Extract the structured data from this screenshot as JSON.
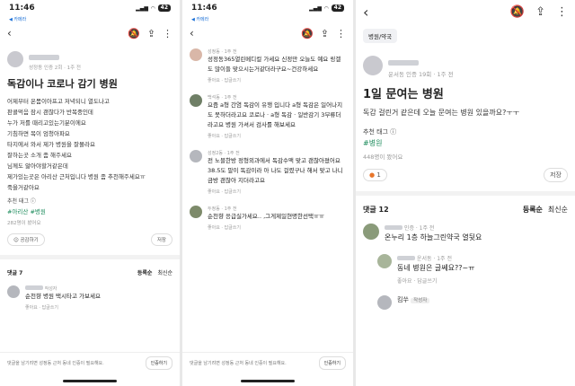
{
  "panel1": {
    "status_time": "11:46",
    "status_sub": "◀ 카메라",
    "battery": "42",
    "meta": "성정동 인증 2회 · 1주 전",
    "title": "독감이나 코로나 감기 병원",
    "body_lines": [
      "어제부터 온몸이아프고 저녁되니 열도나고",
      "판콜먹음 잠시 괜찮다가 반복중인데",
      "누가 저를 때리고있는기분이에요",
      "기침하면 목이 엄청아파요",
      "타지에서 와서 제가 병원을 잘몰라요",
      "잘하는곳 소개 좀 해주세요",
      "님께도 앓아야할거같은데",
      "제가있는곳은 아리산 근처입니다 병원 좀 추천해주세요ㅠ",
      "죽을거같아요"
    ],
    "tag_label": "추천 태그 ⓘ",
    "tags": "#아리산 #병원",
    "views": "282명이 봤어요",
    "like": "공감하기",
    "save": "저장",
    "comments_label": "댓글 7",
    "sort1": "등록순",
    "sort2": "최신순",
    "comment_meta": "작성자",
    "comment_text": "순천향 병원 택시타고 가보세요",
    "comment_actions": "좋아요 · 답글쓰기",
    "bottom_text": "댓글을 남기려면 성정동 근처 동네 인증이 필요해요.",
    "bottom_btn": "인증하기"
  },
  "panel2": {
    "status_time": "11:46",
    "status_sub": "◀ 카메라",
    "battery": "42",
    "comments": [
      {
        "meta": "성정동 · 1주 전",
        "text": "성정동365열린메디컬 가세요 신정만 오늘도 예요 링겔도 많이들 맞으시는거같더라구요~건강하세요",
        "actions": "좋아요 · 답글쓰기"
      },
      {
        "meta": "백석동 · 1주 전",
        "text": "요즘 a형 간염 독감이 유행 입니다 a형 독감은 일어나지도 못하더라고요 코로나 · a형 독감 · 일반감기 3부류더라고요 병원 가셔서 검사를 해보세요",
        "actions": "좋아요 · 답글쓰기"
      },
      {
        "meta": "성정2동 · 1주 전",
        "text": "전 노블한방 정형외과에서 독감수액 맞고 괜찮아졌어요 38.5도 말이 독감이라 아 나도 걸렸구나 해서 맞고 나니 금방 괜찮아 지더라고요",
        "actions": "좋아요 · 답글쓰기"
      },
      {
        "meta": "두정동 · 1주 전",
        "text": "순천향 응급실가세요.. ,그게제일현명한선택ㅠㅠ",
        "actions": "좋아요 · 답글쓰기"
      }
    ],
    "bottom_text": "댓글을 남기려면 성정동 근처 동네 인증이 필요해요.",
    "bottom_btn": "인증하기"
  },
  "panel3": {
    "badge": "병원/약국",
    "meta": "운서동 인증 19회 · 1주 전",
    "title": "1일 문여는 병원",
    "body": "독감 걸린거 같은데 오늘 문여는 병원 있을까요?ㅜㅜ",
    "tag_label": "추천 태그 ⓘ",
    "tags": "#병원",
    "views": "448명이 봤어요",
    "reaction_count": "1",
    "save": "저장",
    "comments_label": "댓글 12",
    "sort1": "등록순",
    "sort2": "최신순",
    "c1_meta": "인증 · 1주 전",
    "c1_text": "온누리 1층 하늘그린약국 열뒷요",
    "c2_meta": "운서동 · 1주 전",
    "c2_text": "동네 병원은 글쎄요??~ㅠ",
    "c2_actions": "좋아요 · 답글쓰기",
    "c3_name": "킴쑤",
    "c3_tag": "작성자"
  }
}
